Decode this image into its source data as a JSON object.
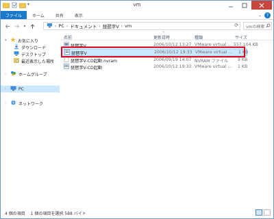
{
  "window": {
    "title": "vm"
  },
  "ribbon": {
    "tabs": [
      "ファイル",
      "ホーム",
      "共有",
      "表示"
    ]
  },
  "address": {
    "crumbs": [
      "PC",
      "ドキュメント",
      "琵琶字V",
      "vm"
    ],
    "search_placeholder": "vmの検索"
  },
  "nav": {
    "favorites": "お気に入り",
    "downloads": "ダウンロード",
    "desktop": "デスクトップ",
    "recent": "最近表示した場所",
    "homegroup": "ホームグループ",
    "pc": "PC",
    "network": "ネットワーク"
  },
  "columns": {
    "name": "名前",
    "date": "更新日時",
    "type": "種類",
    "size": "サイズ"
  },
  "files": [
    {
      "name": "琵琶字V",
      "date": "2006/10/12 13:27",
      "type": "VMware virtual ...",
      "size": "557,104 KB"
    },
    {
      "name": "琵琶字V",
      "date": "2006/10/12 19:33",
      "type": "VMware virtual ...",
      "size": "1 KB"
    },
    {
      "name": "琵琶字V-CD起動.nvram",
      "date": "2006/09/19 14:07",
      "type": "NVRAM ファイル",
      "size": "9 KB"
    },
    {
      "name": "琵琶字V-CD起動",
      "date": "2006/10/12 19:33",
      "type": "VMware virtual ...",
      "size": "1 KB"
    }
  ],
  "status": {
    "count": "4 個の項目",
    "selection": "1 個の項目を選択 588 バイト"
  },
  "colors": {
    "accent": "#1979ca",
    "highlight": "#e3001b",
    "selected": "#cce8ff"
  }
}
